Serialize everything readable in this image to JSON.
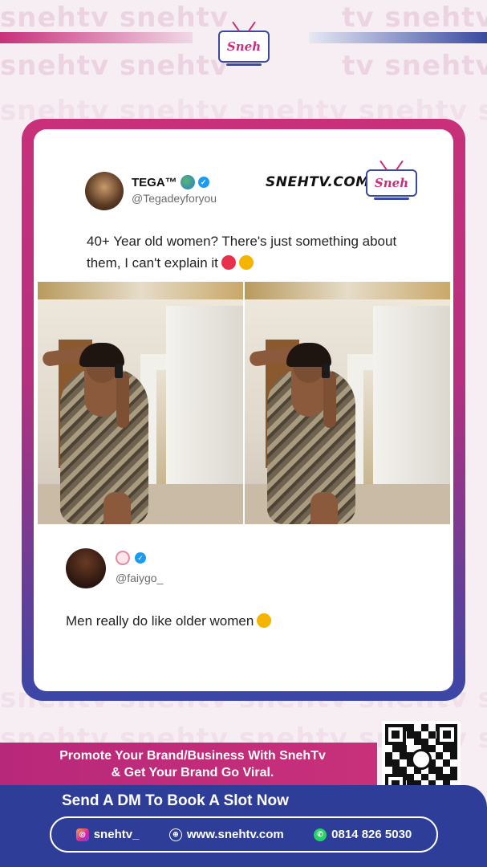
{
  "brand": {
    "name": "snehtv",
    "logo_text": "Sneh",
    "site_stamp": "SNEHTV.COM",
    "colors": {
      "magenta": "#c8307a",
      "navy": "#2e3e98",
      "bg": "#f7eef4"
    }
  },
  "tweet": {
    "author_name": "TEGA™",
    "author_handle": "@Tegadeyforyou",
    "text": "40+ Year old women? There's just something about them, I can't explain it"
  },
  "reply": {
    "author_handle": "@faiygo_",
    "text": "Men really do like older women"
  },
  "promo": {
    "line1": "Promote Your Brand/Business With SnehTv",
    "line2": "& Get Your Brand Go Viral."
  },
  "footer": {
    "cta": "Send A DM To Book A Slot Now",
    "instagram": "snehtv_",
    "website": "www.snehtv.com",
    "whatsapp": "0814 826 5030"
  },
  "icons": [
    "globe-icon",
    "verified-icon",
    "instagram-icon",
    "web-icon",
    "whatsapp-icon",
    "qr-code"
  ]
}
